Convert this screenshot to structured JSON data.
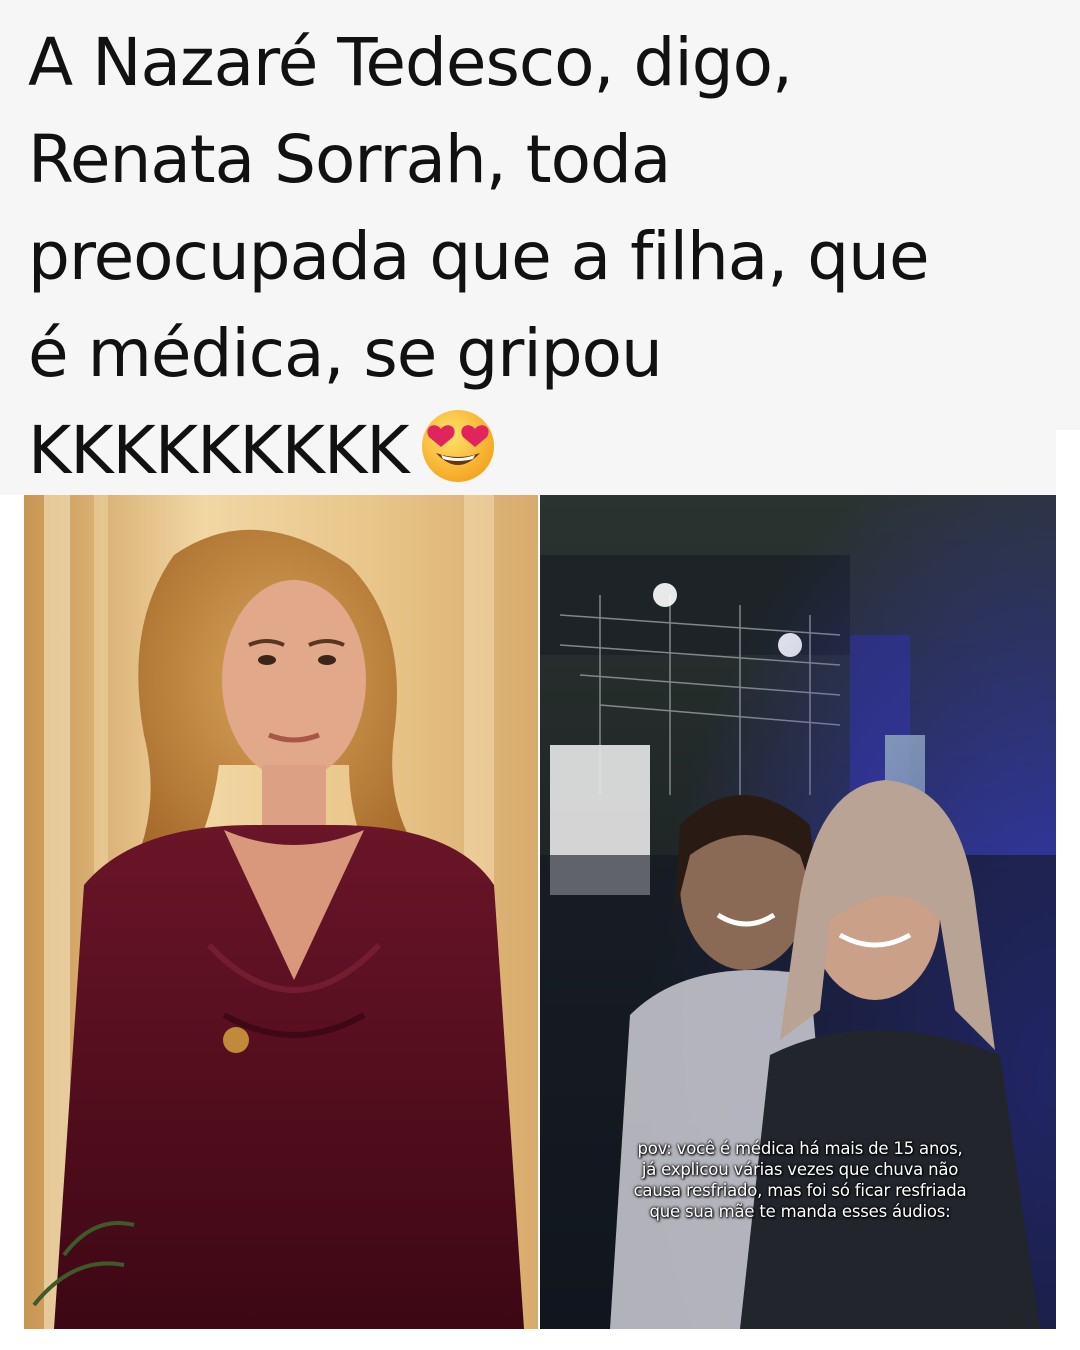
{
  "headline": {
    "lines": [
      "A Nazaré Tedesco, digo,",
      "Renata Sorrah, toda",
      "preocupada que a filha, que",
      "é médica, se gripou",
      "KKKKKKKKK"
    ],
    "emoji_icon": "heart-eyes-emoji-icon"
  },
  "left_photo": {
    "image": "woman-in-burgundy-velvet-dress-photo"
  },
  "right_photo": {
    "image": "two-women-at-concert-photo",
    "caption_lines": [
      "pov: você é médica há mais de 15 anos,",
      "já explicou várias vezes que chuva não",
      "causa resfriado, mas foi só ficar resfriada",
      "que sua mãe te manda esses áudios:"
    ]
  },
  "colors": {
    "headline_text": "#111111",
    "headline_background": "#f6f6f6",
    "dress": "#5a1020",
    "concert_light": "#3b3fe0"
  }
}
